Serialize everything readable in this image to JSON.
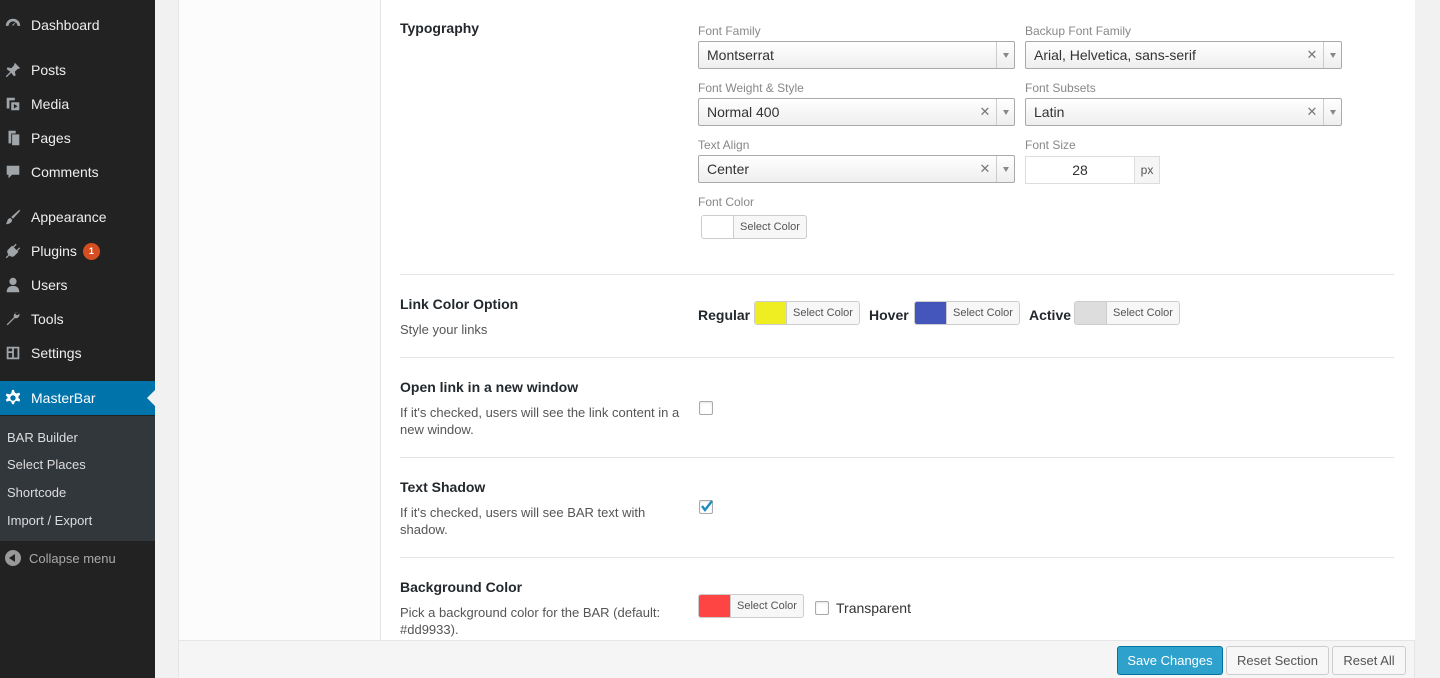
{
  "sidebar": {
    "items": [
      {
        "label": "Dashboard",
        "icon": "dashboard-icon"
      },
      {
        "label": "Posts",
        "icon": "pin-icon"
      },
      {
        "label": "Media",
        "icon": "media-icon"
      },
      {
        "label": "Pages",
        "icon": "pages-icon"
      },
      {
        "label": "Comments",
        "icon": "comments-icon"
      },
      {
        "label": "Appearance",
        "icon": "brush-icon"
      },
      {
        "label": "Plugins",
        "icon": "plugin-icon",
        "badge": "1"
      },
      {
        "label": "Users",
        "icon": "user-icon"
      },
      {
        "label": "Tools",
        "icon": "wrench-icon"
      },
      {
        "label": "Settings",
        "icon": "settings-icon"
      },
      {
        "label": "MasterBar",
        "icon": "gear-icon"
      }
    ],
    "submenu": [
      "BAR Builder",
      "Select Places",
      "Shortcode",
      "Import / Export"
    ],
    "collapse": "Collapse menu"
  },
  "typography": {
    "title": "Typography",
    "font_family": {
      "label": "Font Family",
      "value": "Montserrat"
    },
    "backup_font_family": {
      "label": "Backup Font Family",
      "value": "Arial, Helvetica, sans-serif"
    },
    "font_weight": {
      "label": "Font Weight & Style",
      "value": "Normal 400"
    },
    "font_subsets": {
      "label": "Font Subsets",
      "value": "Latin"
    },
    "text_align": {
      "label": "Text Align",
      "value": "Center"
    },
    "font_size": {
      "label": "Font Size",
      "value": "28",
      "unit": "px"
    },
    "font_color": {
      "label": "Font Color",
      "button": "Select Color",
      "color": "#ffffff"
    }
  },
  "link_color": {
    "title": "Link Color Option",
    "desc": "Style your links",
    "regular": {
      "label": "Regular",
      "button": "Select Color",
      "color": "#eeee22"
    },
    "hover": {
      "label": "Hover",
      "button": "Select Color",
      "color": "#4455bb"
    },
    "active": {
      "label": "Active",
      "button": "Select Color",
      "color": "#dddddd"
    }
  },
  "open_link": {
    "title": "Open link in a new window",
    "desc": "If it's checked, users will see the link content in a new window.",
    "checked": false
  },
  "text_shadow": {
    "title": "Text Shadow",
    "desc": "If it's checked, users will see BAR text with shadow.",
    "checked": true
  },
  "background_color": {
    "title": "Background Color",
    "desc": "Pick a background color for the BAR (default: #dd9933).",
    "button": "Select Color",
    "color": "#ff4444",
    "transparent_label": "Transparent"
  },
  "footer": {
    "save": "Save Changes",
    "reset_section": "Reset Section",
    "reset_all": "Reset All"
  }
}
